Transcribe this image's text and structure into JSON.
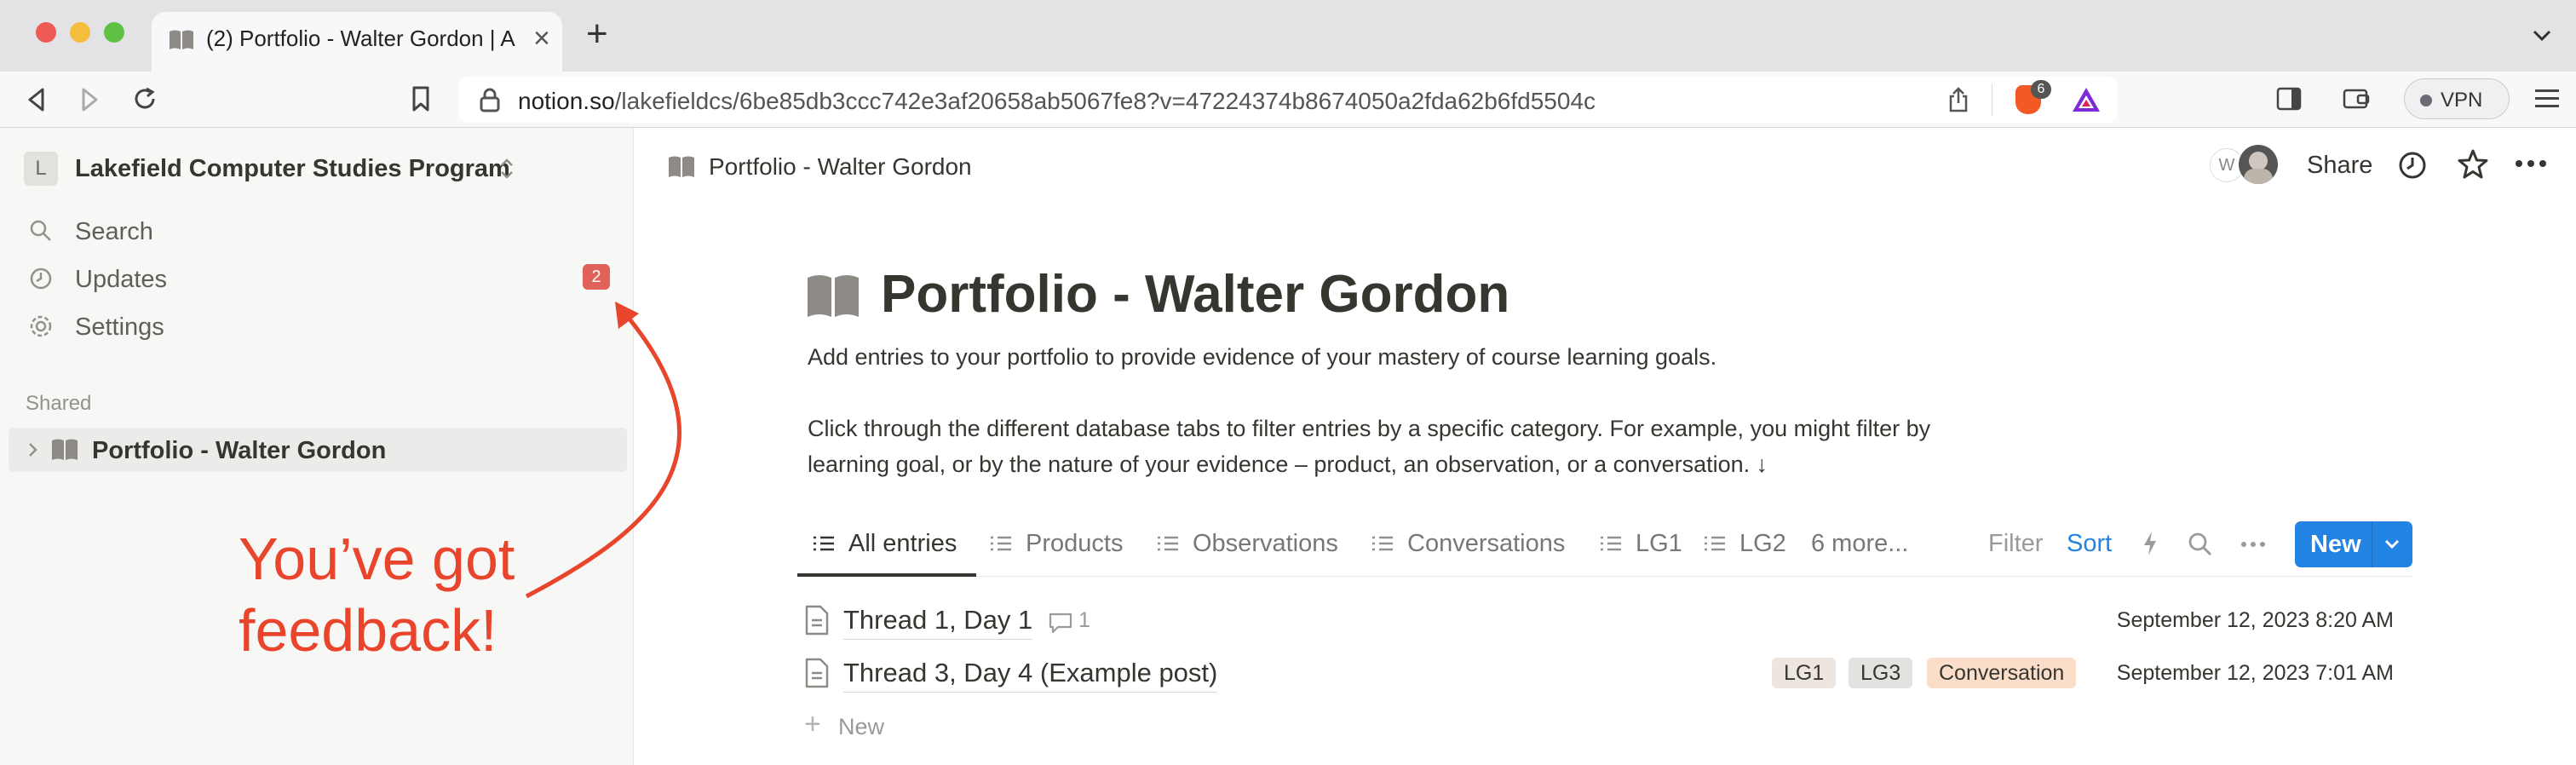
{
  "browser": {
    "tab_title": "(2) Portfolio - Walter Gordon | A",
    "url_host": "notion.so",
    "url_path": "/lakefieldcs/6be85db3ccc742e3af20658ab5067fe8?v=47224374b8674050a2fda62b6fd5504c",
    "brave_badge": "6",
    "vpn_label": "VPN"
  },
  "sidebar": {
    "workspace_initial": "L",
    "workspace_name": "Lakefield Computer Studies Program",
    "search": "Search",
    "updates": "Updates",
    "updates_badge": "2",
    "settings": "Settings",
    "shared_label": "Shared",
    "shared_page": "Portfolio - Walter Gordon"
  },
  "topbar": {
    "breadcrumb": "Portfolio - Walter Gordon",
    "avatar_initial": "W",
    "share": "Share"
  },
  "page": {
    "title": "Portfolio - Walter Gordon",
    "desc1": "Add entries to your portfolio to provide evidence of your mastery of course learning goals.",
    "desc2": "Click through the different database tabs to filter entries by a specific category. For example, you might filter by",
    "desc3": "learning goal, or by the nature of your evidence – product, an observation, or a conversation. ↓"
  },
  "db": {
    "tabs": [
      "All entries",
      "Products",
      "Observations",
      "Conversations",
      "LG1",
      "LG2",
      "6 more..."
    ],
    "filter": "Filter",
    "sort": "Sort",
    "new": "New",
    "rows": [
      {
        "title": "Thread 1, Day 1",
        "comments": "1",
        "date": "September 12, 2023 8:20 AM",
        "tags": []
      },
      {
        "title": "Thread 3, Day 4 (Example post)",
        "date": "September 12, 2023 7:01 AM",
        "tags": [
          "LG1",
          "LG3",
          "Conversation"
        ]
      }
    ],
    "add_new": "New"
  },
  "annotation": {
    "line1": "You’ve got",
    "line2": "feedback!",
    "color": "#e8452c"
  },
  "colors": {
    "accent": "#2383e2",
    "badge": "#e16259",
    "tag_lg1": "#ede5e0",
    "tag_lg3": "#e3e2e0",
    "tag_conversation": "#fadec9"
  },
  "icons": [
    "book-icon",
    "search-icon",
    "clock-icon",
    "gear-icon",
    "page-icon",
    "comment-icon",
    "lightning-icon",
    "star-icon",
    "more-icon",
    "list-icon"
  ]
}
